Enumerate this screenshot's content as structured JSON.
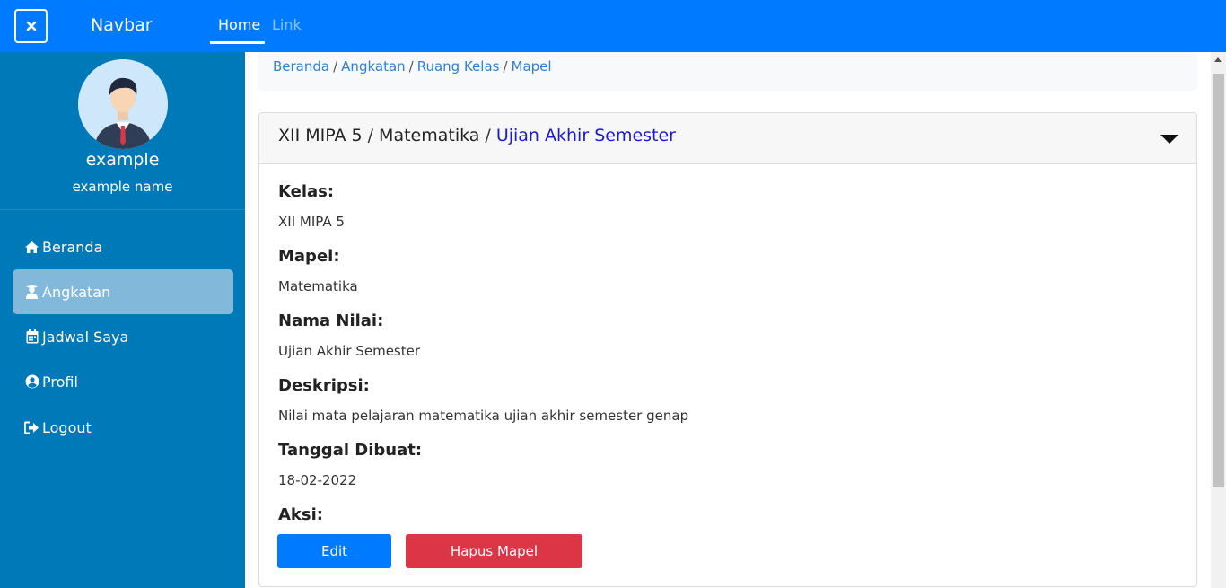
{
  "navbar": {
    "toggle_icon": "close-icon",
    "brand": "Navbar",
    "links": [
      {
        "label": "Home",
        "active": true
      },
      {
        "label": "Link",
        "active": false
      }
    ],
    "color": "#007bff"
  },
  "sidebar": {
    "color": "#0079b8",
    "profile": {
      "username": "example",
      "name": "example name",
      "avatar_icon": "businessman-avatar"
    },
    "items": [
      {
        "label": "Beranda",
        "icon": "home-icon",
        "active": false
      },
      {
        "label": "Angkatan",
        "icon": "user-graduate-icon",
        "active": true
      },
      {
        "label": "Jadwal Saya",
        "icon": "calendar-icon",
        "active": false
      },
      {
        "label": "Profil",
        "icon": "user-circle-icon",
        "active": false
      },
      {
        "label": "Logout",
        "icon": "sign-out-icon",
        "active": false
      }
    ]
  },
  "breadcrumb": {
    "items": [
      "Beranda",
      "Angkatan",
      "Ruang Kelas",
      "Mapel"
    ],
    "separator": "/"
  },
  "card": {
    "header": {
      "class": "XII MIPA 5",
      "subject": "Matematika",
      "exam": "Ujian Akhir Semester",
      "separator": "/"
    },
    "fields": [
      {
        "label": "Kelas:",
        "value": "XII MIPA 5"
      },
      {
        "label": "Mapel:",
        "value": "Matematika"
      },
      {
        "label": "Nama Nilai:",
        "value": "Ujian Akhir Semester"
      },
      {
        "label": "Deskripsi:",
        "value": "Nilai mata pelajaran matematika ujian akhir semester genap"
      },
      {
        "label": "Tanggal Dibuat:",
        "value": "18-02-2022"
      }
    ],
    "actions_label": "Aksi:",
    "buttons": {
      "edit": "Edit",
      "delete": "Hapus Mapel"
    }
  }
}
